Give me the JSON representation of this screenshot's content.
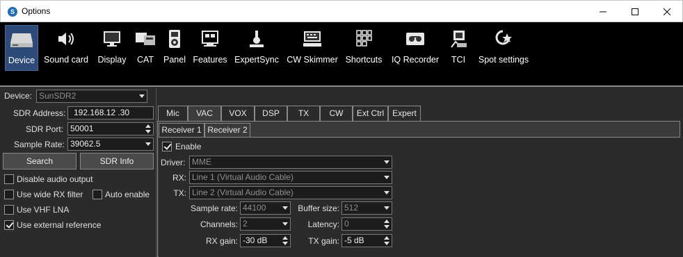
{
  "window": {
    "title": "Options",
    "app_icon": "app-logo-icon"
  },
  "toolbar": {
    "items": [
      {
        "label": "Device",
        "icon": "device-icon"
      },
      {
        "label": "Sound card",
        "icon": "speaker-icon"
      },
      {
        "label": "Display",
        "icon": "monitor-icon"
      },
      {
        "label": "CAT",
        "icon": "cat-icon"
      },
      {
        "label": "Panel",
        "icon": "panel-icon"
      },
      {
        "label": "Features",
        "icon": "features-icon"
      },
      {
        "label": "ExpertSync",
        "icon": "expertsync-icon"
      },
      {
        "label": "CW Skimmer",
        "icon": "keyboard-icon"
      },
      {
        "label": "Shortcuts",
        "icon": "shortcuts-icon"
      },
      {
        "label": "IQ Recorder",
        "icon": "tape-icon"
      },
      {
        "label": "TCI",
        "icon": "tci-icon"
      },
      {
        "label": "Spot settings",
        "icon": "spot-icon"
      }
    ],
    "active": "Device"
  },
  "device": {
    "label": "Device:",
    "value": "SunSDR2",
    "sdr_address_label": "SDR Address:",
    "sdr_address_value": "192.168.12 .30",
    "sdr_port_label": "SDR Port:",
    "sdr_port_value": "50001",
    "sample_rate_label": "Sample Rate:",
    "sample_rate_value": "39062.5",
    "search_button": "Search",
    "sdr_info_button": "SDR Info",
    "checkboxes": [
      {
        "label": "Disable audio output",
        "checked": false
      },
      {
        "label": "Use wide RX filter",
        "checked": false
      },
      {
        "label": "Auto enable",
        "checked": false
      },
      {
        "label": "Use VHF LNA",
        "checked": false
      },
      {
        "label": "Use external reference",
        "checked": true
      }
    ]
  },
  "tabs": {
    "items": [
      "Mic",
      "VAC",
      "VOX",
      "DSP",
      "TX",
      "CW",
      "Ext Ctrl",
      "Expert"
    ],
    "active": "VAC"
  },
  "subtabs": {
    "items": [
      "Receiver 1",
      "Receiver 2"
    ],
    "active": "Receiver 1"
  },
  "vac": {
    "enable_label": "Enable",
    "enable_checked": true,
    "driver_label": "Driver:",
    "driver_value": "MME",
    "rx_label": "RX:",
    "rx_value": "Line 1 (Virtual Audio Cable)",
    "tx_label": "TX:",
    "tx_value": "Line 2 (Virtual Audio Cable)",
    "sample_rate_label": "Sample rate:",
    "sample_rate_value": "44100",
    "buffer_size_label": "Buffer size:",
    "buffer_size_value": "512",
    "channels_label": "Channels:",
    "channels_value": "2",
    "latency_label": "Latency:",
    "latency_value": "0",
    "rx_gain_label": "RX gain:",
    "rx_gain_value": "-30 dB",
    "tx_gain_label": "TX gain:",
    "tx_gain_value": "-5 dB"
  },
  "colors": {
    "toolbar_bg": "#000000",
    "panel_bg": "#2b2b2b",
    "active_tool": "#2e4a78"
  }
}
